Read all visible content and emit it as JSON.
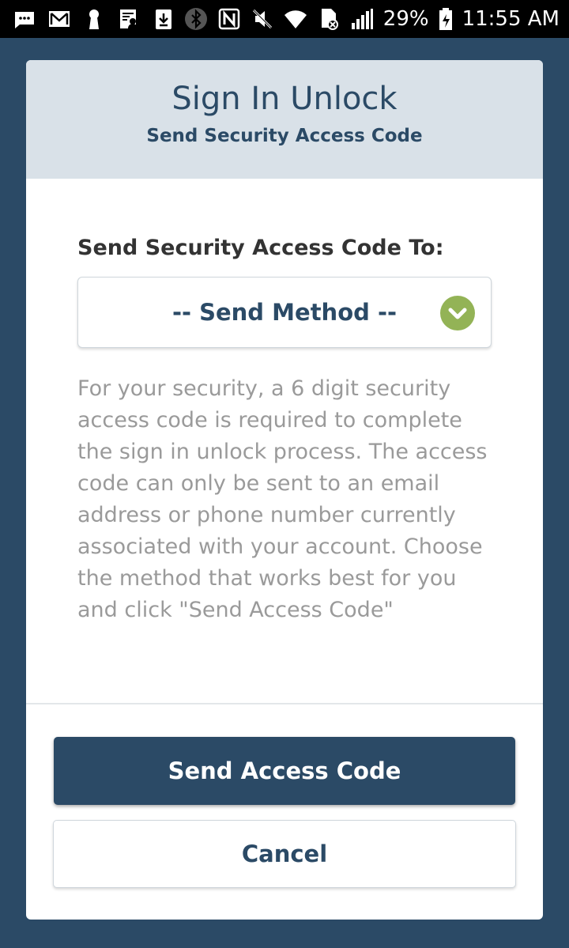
{
  "status_bar": {
    "left_icons": [
      "messages-icon",
      "gmail-icon",
      "keyhole-icon",
      "document-person-icon",
      "download-icon"
    ],
    "right_icons": [
      "bluetooth-icon",
      "nfc-icon",
      "mute-icon",
      "wifi-icon",
      "sim-error-icon",
      "signal-icon"
    ],
    "battery": "29%",
    "time": "11:55 AM"
  },
  "dialog": {
    "title": "Sign In Unlock",
    "subtitle": "Send Security Access Code",
    "field_label": "Send Security Access Code To:",
    "select": {
      "value": "-- Send Method --",
      "icon": "chevron-down-icon"
    },
    "info_text": "For your security, a 6 digit security access code is required to complete the sign in unlock process. The access code can only be sent to an email address or phone number currently associated with your account. Choose the method that works best for you and click \"Send Access Code\"",
    "primary_button": "Send Access Code",
    "secondary_button": "Cancel"
  },
  "colors": {
    "background": "#2b4a66",
    "header_bg": "#d9e1e8",
    "accent": "#2b4a66",
    "chevron_badge": "#93b356",
    "info_text": "#9a9a9a"
  }
}
